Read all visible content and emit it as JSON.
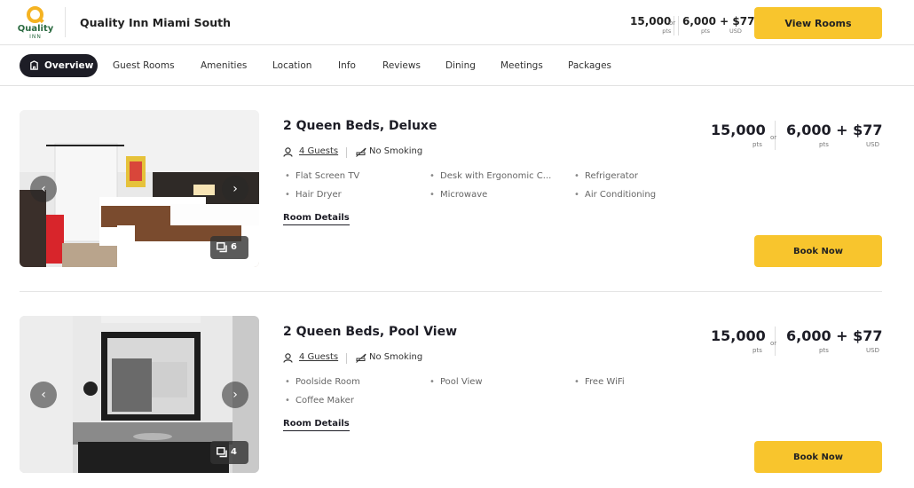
{
  "header": {
    "logo_text": "Quality",
    "logo_sub": "INN",
    "hotel_name": "Quality Inn Miami South",
    "price_points": "15,000",
    "price_points_label": "pts",
    "or": "or",
    "price_mixed": "6,000 + $77",
    "price_mixed_pts": "pts",
    "price_mixed_usd": "USD",
    "view_rooms_label": "View Rooms"
  },
  "nav": {
    "tabs": [
      {
        "label": "Overview",
        "active": true
      },
      {
        "label": "Guest Rooms"
      },
      {
        "label": "Amenities"
      },
      {
        "label": "Location"
      },
      {
        "label": "Info"
      },
      {
        "label": "Reviews"
      },
      {
        "label": "Dining"
      },
      {
        "label": "Meetings"
      },
      {
        "label": "Packages"
      }
    ]
  },
  "rooms": [
    {
      "title": "2 Queen Beds, Deluxe",
      "guests": "4 Guests",
      "smoking": "No Smoking",
      "amenities": [
        "Flat Screen TV",
        "Desk with Ergonomic C...",
        "Refrigerator",
        "Hair Dryer",
        "Microwave",
        "Air Conditioning"
      ],
      "details_label": "Room Details",
      "photo_count": "6",
      "points": "15,000",
      "points_label": "pts",
      "or": "or",
      "cash": "6,000 + $77",
      "cash_pts": "pts",
      "cash_usd": "USD",
      "book_label": "Book Now"
    },
    {
      "title": "2 Queen Beds, Pool View",
      "guests": "4 Guests",
      "smoking": "No Smoking",
      "amenities": [
        "Poolside Room",
        "Pool View",
        "Free WiFi",
        "Coffee Maker"
      ],
      "details_label": "Room Details",
      "photo_count": "4",
      "points": "15,000",
      "points_label": "pts",
      "or": "or",
      "cash": "6,000 + $77",
      "cash_pts": "pts",
      "cash_usd": "USD",
      "book_label": "Book Now"
    }
  ],
  "colors": {
    "accent": "#f8c52d",
    "nav_active_bg": "#1d1d26",
    "logo_gold": "#f5b322",
    "logo_green": "#2b6a41"
  }
}
